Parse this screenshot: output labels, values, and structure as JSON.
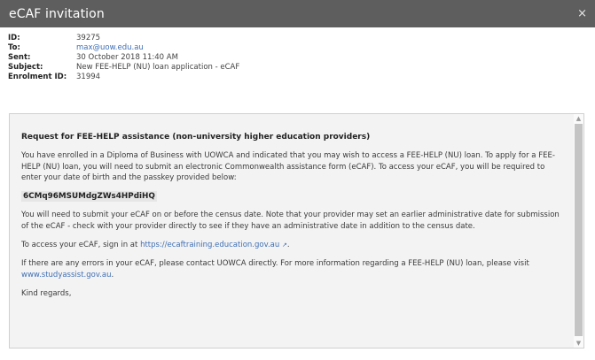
{
  "dialog": {
    "title": "eCAF invitation",
    "close_label": "×"
  },
  "meta": [
    {
      "label": "ID:",
      "value": "39275",
      "link": false
    },
    {
      "label": "To:",
      "value": "max@uow.edu.au",
      "link": true
    },
    {
      "label": "Sent:",
      "value": "30 October 2018 11:40 AM",
      "link": false
    },
    {
      "label": "Subject:",
      "value": "New FEE-HELP (NU) loan application - eCAF",
      "link": false
    },
    {
      "label": "Enrolment ID:",
      "value": "31994",
      "link": false
    }
  ],
  "message": {
    "heading": "Request for FEE-HELP assistance (non-university higher education providers)",
    "para1": "You have enrolled in a Diploma of Business with UOWCA and indicated that you may wish to access a FEE-HELP (NU) loan. To apply for a FEE-HELP (NU) loan, you will need to submit an electronic Commonwealth assistance form (eCAF). To access your eCAF, you will be required to enter your date of birth and the passkey provided below:",
    "passkey": "6CMq96MSUMdgZWs4HPdiHQ",
    "para2": "You will need to submit your eCAF on or before the census date. Note that your provider may set an earlier administrative date for submission of the eCAF - check with your provider directly to see if they have an administrative date in addition to the census date.",
    "para3_prefix": "To access your eCAF, sign in at ",
    "para3_link": "https://ecaftraining.education.gov.au",
    "para3_suffix": ".",
    "para4_prefix": "If there are any errors in your eCAF, please contact UOWCA directly. For more information regarding a FEE-HELP (NU) loan, please visit ",
    "para4_link": "www.studyassist.gov.au",
    "para4_suffix": ".",
    "signoff": "Kind regards,"
  },
  "icons": {
    "external_link": "external-link-icon",
    "close": "close-icon"
  },
  "colors": {
    "titlebar": "#5e5e5e",
    "link": "#3f6fb5",
    "message_bg": "#f3f3f3"
  }
}
